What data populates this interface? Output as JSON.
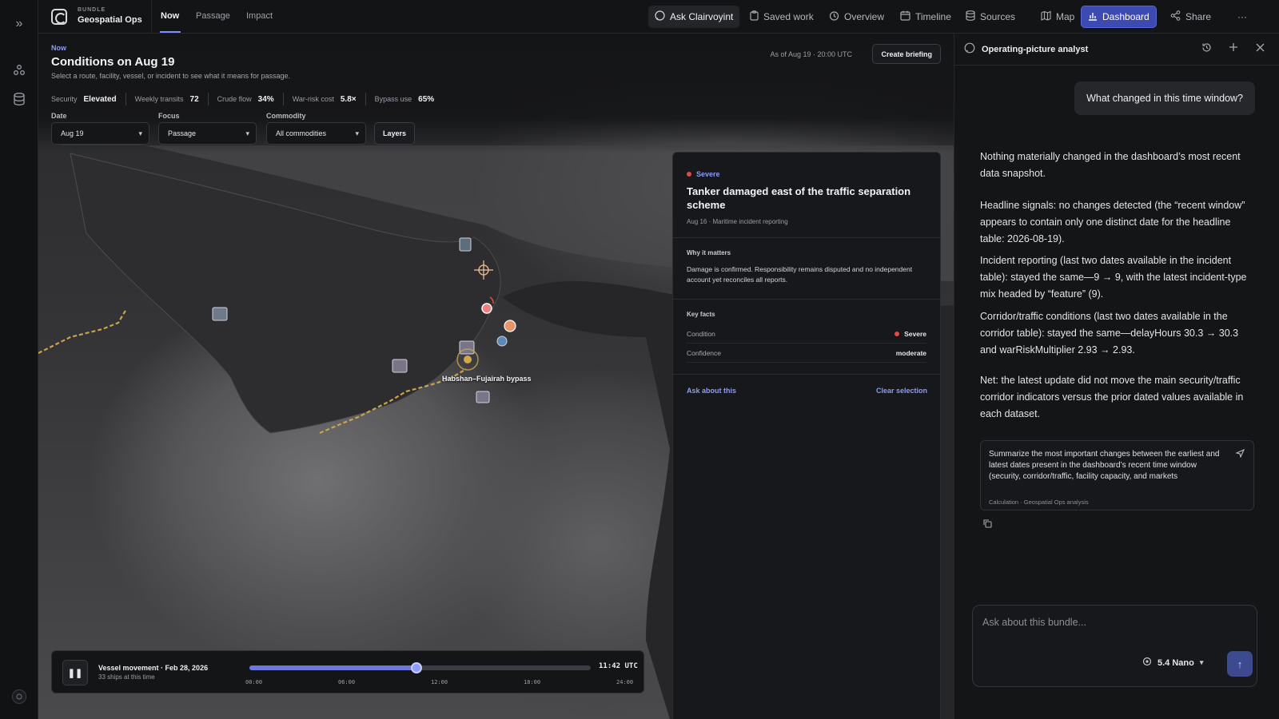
{
  "brand": {
    "bundle_label": "BUNDLE",
    "name": "Geospatial Ops"
  },
  "top_tabs": [
    {
      "label": "Now"
    },
    {
      "label": "Passage"
    },
    {
      "label": "Impact"
    }
  ],
  "toolbar": {
    "ask_label": "Ask Clairvoyint",
    "saved_label": "Saved work",
    "overview_label": "Overview",
    "timeline_label": "Timeline",
    "sources_label": "Sources",
    "map_label": "Map",
    "dashboard_label": "Dashboard",
    "share_label": "Share",
    "more_label": "···"
  },
  "page": {
    "eyebrow": "Now",
    "title": "Conditions on Aug 19",
    "subtitle": "Select a route, facility, vessel, or incident to see what it means for passage.",
    "as_of": "As of Aug 19 · 20:00 UTC",
    "create_briefing": "Create briefing"
  },
  "metrics": [
    {
      "label": "Security",
      "value": "Elevated"
    },
    {
      "label": "Weekly transits",
      "value": "72"
    },
    {
      "label": "Crude flow",
      "value": "34%"
    },
    {
      "label": "War-risk cost",
      "value": "5.8×"
    },
    {
      "label": "Bypass use",
      "value": "65%"
    }
  ],
  "filters": {
    "date": {
      "label": "Date",
      "value": "Aug 19"
    },
    "focus": {
      "label": "Focus",
      "value": "Passage"
    },
    "commodity": {
      "label": "Commodity",
      "value": "All commodities"
    },
    "layers_label": "Layers"
  },
  "map": {
    "route_label": "Habshan–Fujairah bypass"
  },
  "incident": {
    "severity": "Severe",
    "title": "Tanker damaged east of the traffic separation scheme",
    "meta": "Aug 16 · Maritime incident reporting",
    "why_heading": "Why it matters",
    "why_body": "Damage is confirmed. Responsibility remains disputed and no independent account yet reconciles all reports.",
    "facts_heading": "Key facts",
    "facts": [
      {
        "key": "Condition",
        "value": "Severe"
      },
      {
        "key": "Confidence",
        "value": "moderate"
      }
    ],
    "ask_label": "Ask about this",
    "clear_label": "Clear selection"
  },
  "timeline": {
    "title": "Vessel movement · Feb 28, 2026",
    "subtitle": "33 ships at this time",
    "time": "11:42 UTC",
    "progress": 0.49,
    "ticks": [
      "00:00",
      "06:00",
      "12:00",
      "18:00",
      "24:00"
    ]
  },
  "assistant": {
    "title": "Operating-picture analyst",
    "user_message": "What changed in this time window?",
    "answer": [
      "Nothing materially changed in the dashboard’s most recent data snapshot.",
      "Headline signals: no changes detected (the “recent window” appears to contain only one distinct date for the headline table: 2026-08-19).",
      "Incident reporting (last two dates available in the incident table): stayed the same—9 → 9, with the latest incident-type mix headed by “feature” (9).",
      "Corridor/traffic conditions (last two dates available in the corridor table): stayed the same—delayHours 30.3 → 30.3 and warRiskMultiplier 2.93 → 2.93.",
      "Net: the latest update did not move the main security/traffic corridor indicators versus the prior dated values available in each dataset."
    ],
    "suggestion": {
      "text": "Summarize the most important changes between the earliest and latest dates present in the dashboard’s recent time window (security, corridor/traffic, facility capacity, and markets",
      "meta": "Calculation · Geospatial Ops analysis"
    },
    "composer_placeholder": "Ask about this bundle...",
    "model": "5.4 Nano"
  },
  "colors": {
    "accent": "#7f8cf7",
    "primary_button": "#3d4ab1",
    "severe": "#e1474e"
  }
}
